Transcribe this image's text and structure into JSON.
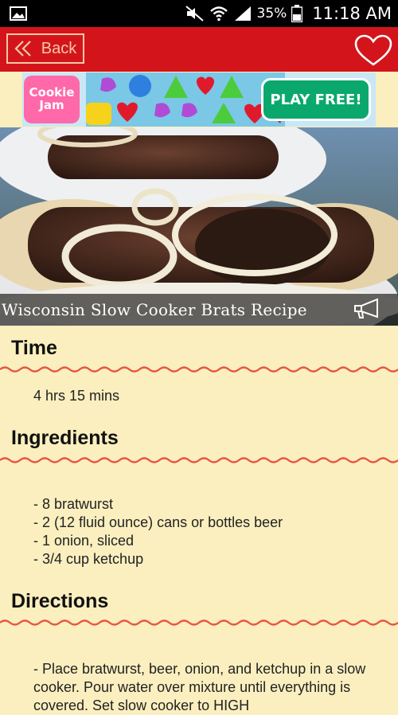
{
  "status_bar": {
    "battery": "35%",
    "time": "11:18 AM"
  },
  "app_bar": {
    "back_label": "Back",
    "favorite_icon": "heart-outline-icon"
  },
  "ad": {
    "brand": "Cookie Jam",
    "cta": "PLAY FREE!"
  },
  "recipe": {
    "title": "Wisconsin Slow Cooker Brats Recipe",
    "sections": {
      "time": {
        "heading": "Time",
        "value": "4 hrs 15 mins"
      },
      "ingredients": {
        "heading": "Ingredients",
        "items": [
          "-  8 bratwurst",
          "-  2 (12 fluid ounce) cans or bottles beer",
          "-  1 onion, sliced",
          "-  3/4 cup ketchup"
        ]
      },
      "directions": {
        "heading": "Directions",
        "text": " - Place bratwurst, beer, onion, and ketchup in a slow cooker. Pour water over mixture until everything is covered. Set slow cooker to HIGH"
      }
    }
  },
  "colors": {
    "app_bar": "#d3151b",
    "background": "#fbefbf",
    "divider_wave": "#e8553e"
  }
}
